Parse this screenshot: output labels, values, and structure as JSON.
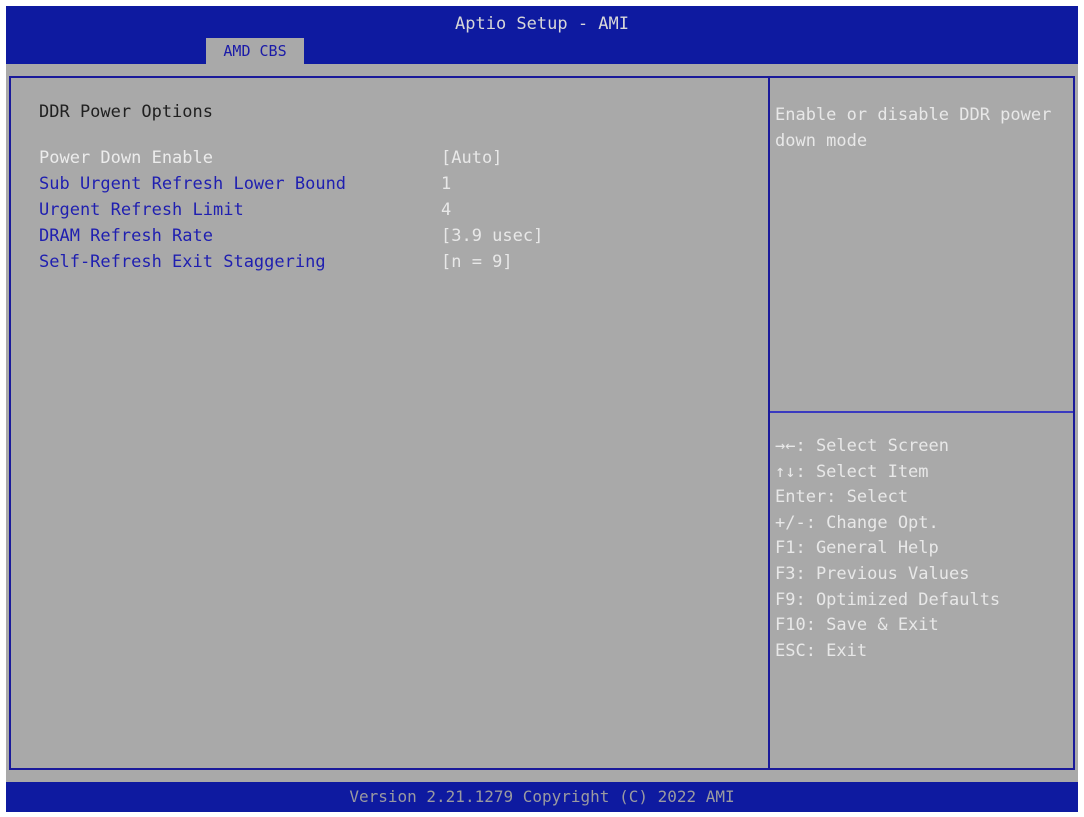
{
  "header": {
    "title": "Aptio Setup - AMI",
    "active_tab": "AMD CBS"
  },
  "main": {
    "heading": "DDR Power Options",
    "settings": [
      {
        "label": "Power Down Enable",
        "value": "[Auto]"
      },
      {
        "label": "Sub Urgent Refresh Lower Bound",
        "value": "1"
      },
      {
        "label": "Urgent Refresh Limit",
        "value": "4"
      },
      {
        "label": "DRAM Refresh Rate",
        "value": "[3.9 usec]"
      },
      {
        "label": "Self-Refresh Exit Staggering",
        "value": "[n = 9]"
      }
    ]
  },
  "help": {
    "text": "Enable or disable DDR power down mode"
  },
  "keys": [
    "→←: Select Screen",
    "↑↓: Select Item",
    "Enter: Select",
    "+/-: Change Opt.",
    "F1: General Help",
    "F3: Previous Values",
    "F9: Optimized Defaults",
    "F10: Save & Exit",
    "ESC: Exit"
  ],
  "footer": {
    "text": "Version 2.21.1279 Copyright (C) 2022 AMI"
  },
  "colors": {
    "bar_blue": "#0e1aa0",
    "panel_gray": "#a9a9a9",
    "label_blue": "#1f1fb0",
    "value_white": "#e8e8e8"
  }
}
